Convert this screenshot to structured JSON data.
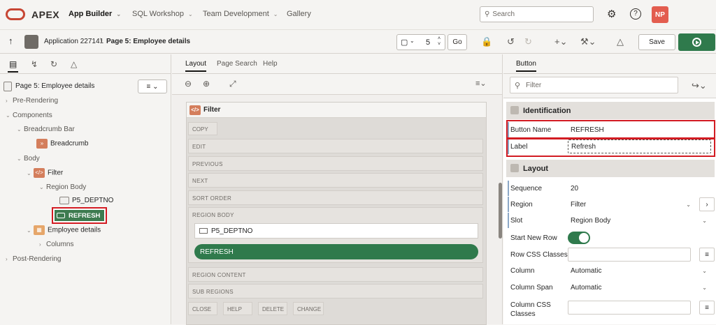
{
  "header": {
    "brand": "APEX",
    "nav": [
      {
        "label": "App Builder",
        "active": true
      },
      {
        "label": "SQL Workshop",
        "active": false
      },
      {
        "label": "Team Development",
        "active": false
      },
      {
        "label": "Gallery",
        "active": false
      }
    ],
    "search_placeholder": "Search",
    "avatar": "NP"
  },
  "toolbar": {
    "app": "Application 227141",
    "page": "Page 5: Employee details",
    "page_number": "5",
    "go": "Go",
    "save": "Save"
  },
  "left": {
    "page_label": "Page 5: Employee details",
    "tree": {
      "pre": "Pre-Rendering",
      "components": "Components",
      "bcbar": "Breadcrumb Bar",
      "breadcrumb": "Breadcrumb",
      "body": "Body",
      "filter": "Filter",
      "region_body": "Region Body",
      "p5": "P5_DEPTNO",
      "refresh": "REFRESH",
      "emp": "Employee details",
      "columns": "Columns",
      "post": "Post-Rendering"
    }
  },
  "middle": {
    "tabs": [
      "Layout",
      "Page Search",
      "Help"
    ],
    "region_title": "Filter",
    "slots": {
      "copy": "COPY",
      "edit": "EDIT",
      "previous": "PREVIOUS",
      "next": "NEXT",
      "sort": "SORT ORDER",
      "region_body": "REGION BODY",
      "region_content": "REGION CONTENT",
      "sub_regions": "SUB REGIONS",
      "close": "CLOSE",
      "help": "HELP",
      "delete": "DELETE",
      "change": "CHANGE"
    },
    "item": "P5_DEPTNO",
    "button": "REFRESH"
  },
  "right": {
    "tab": "Button",
    "filter_placeholder": "Filter",
    "identification": "Identification",
    "button_name_label": "Button Name",
    "button_name": "REFRESH",
    "label_label": "Label",
    "label_value": "Refresh",
    "layout": "Layout",
    "sequence_label": "Sequence",
    "sequence": "20",
    "region_label": "Region",
    "region": "Filter",
    "slot_label": "Slot",
    "slot": "Region Body",
    "start_new_row": "Start New Row",
    "row_css": "Row CSS Classes",
    "column_label": "Column",
    "column": "Automatic",
    "colspan_label": "Column Span",
    "colspan": "Automatic",
    "col_css_1": "Column CSS",
    "col_css_2": "Classes"
  },
  "colors": {
    "accent_green": "#2f7a4c",
    "highlight_red": "#d21b22",
    "brand_red": "#c74634"
  }
}
